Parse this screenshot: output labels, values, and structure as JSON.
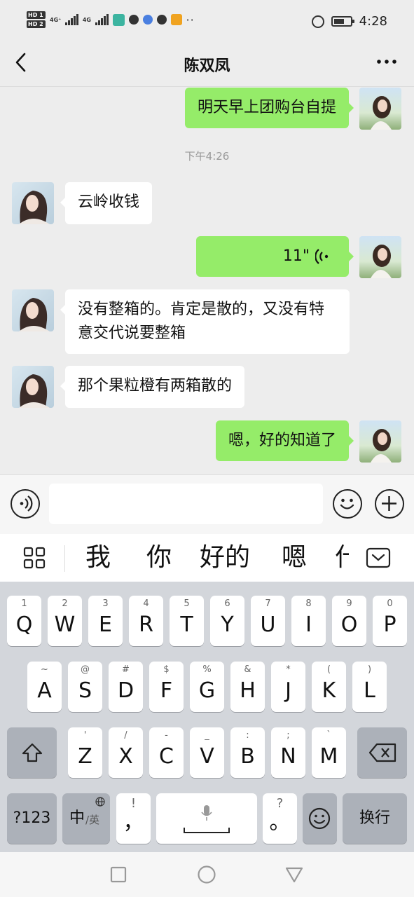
{
  "status_bar": {
    "sim1": "HD 1",
    "sim2": "HD 2",
    "net1": "4G⁺",
    "net2": "4G",
    "more_dots": "··",
    "time": "4:28"
  },
  "nav": {
    "title": "陈双凤"
  },
  "chat": {
    "timestamp": "下午4:26",
    "messages": [
      {
        "dir": "out",
        "text": "明天早上团购台自提"
      },
      {
        "dir": "in",
        "text": "云岭收钱"
      },
      {
        "dir": "out",
        "type": "voice",
        "text": "11\""
      },
      {
        "dir": "in",
        "text": "没有整箱的。肯定是散的，又没有特意交代说要整箱"
      },
      {
        "dir": "in",
        "text": "那个果粒橙有两箱散的"
      },
      {
        "dir": "out",
        "text": "嗯，好的知道了"
      }
    ]
  },
  "input_bar": {
    "text_value": ""
  },
  "candidates": [
    "我",
    "你",
    "好的",
    "嗯",
    "什"
  ],
  "keyboard": {
    "row1": [
      {
        "hint": "1",
        "key": "Q"
      },
      {
        "hint": "2",
        "key": "W"
      },
      {
        "hint": "3",
        "key": "E"
      },
      {
        "hint": "4",
        "key": "R"
      },
      {
        "hint": "5",
        "key": "T"
      },
      {
        "hint": "6",
        "key": "Y"
      },
      {
        "hint": "7",
        "key": "U"
      },
      {
        "hint": "8",
        "key": "I"
      },
      {
        "hint": "9",
        "key": "O"
      },
      {
        "hint": "0",
        "key": "P"
      }
    ],
    "row2": [
      {
        "hint": "~",
        "key": "A"
      },
      {
        "hint": "@",
        "key": "S"
      },
      {
        "hint": "#",
        "key": "D"
      },
      {
        "hint": "$",
        "key": "F"
      },
      {
        "hint": "%",
        "key": "G"
      },
      {
        "hint": "&",
        "key": "H"
      },
      {
        "hint": "*",
        "key": "J"
      },
      {
        "hint": "(",
        "key": "K"
      },
      {
        "hint": ")",
        "key": "L"
      }
    ],
    "row3": [
      {
        "hint": "'",
        "key": "Z"
      },
      {
        "hint": "/",
        "key": "X"
      },
      {
        "hint": "-",
        "key": "C"
      },
      {
        "hint": "_",
        "key": "V"
      },
      {
        "hint": ":",
        "key": "B"
      },
      {
        "hint": ";",
        "key": "N"
      },
      {
        "hint": "`",
        "key": "M"
      }
    ],
    "numbers_label": "?123",
    "lang_main": "中",
    "lang_alt": "/英",
    "comma_hint": "!",
    "comma_key": "，",
    "period_hint": "?",
    "period_key": "。",
    "enter_label": "换行"
  },
  "colors": {
    "outgoing_bubble": "#95ec69",
    "incoming_bubble": "#ffffff",
    "chat_background": "#ededed",
    "keyboard_background": "#d3d6db"
  }
}
